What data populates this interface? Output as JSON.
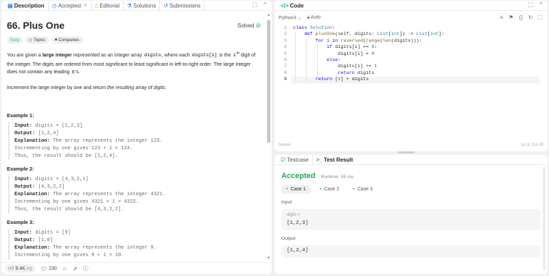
{
  "left_tabs": [
    {
      "label": "Description",
      "icon": "document-icon"
    },
    {
      "label": "Accepted",
      "icon": "clock-icon"
    },
    {
      "label": "Editorial",
      "icon": "book-icon"
    },
    {
      "label": "Solutions",
      "icon": "flask-icon"
    },
    {
      "label": "Submissions",
      "icon": "history-icon"
    }
  ],
  "problem": {
    "title": "66. Plus One",
    "status": "Solved",
    "difficulty": "Easy",
    "tag_topics": "Topics",
    "tag_companies": "Companies",
    "p1_a": "You are given a ",
    "p1_b": "large integer",
    "p1_c": " represented as an integer array ",
    "p1_code1": "digits",
    "p1_d": ", where each ",
    "p1_code2": "digits[i]",
    "p1_e": " is the ",
    "p1_sup_base": "i",
    "p1_sup": "th",
    "p1_f": " digit of the integer. The digits are ordered from most significant to least significant in left-to-right order. The large integer does not contain any leading ",
    "p1_code3": "0",
    "p1_g": "'s.",
    "p2_a": "Increment the large integer by one and return ",
    "p2_i": "the resulting array of digits",
    "p2_b": "."
  },
  "examples": [
    {
      "heading": "Example 1:",
      "input": "digits = [1,2,3]",
      "output": "[1,2,4]",
      "expl1": "The array represents the integer 123.",
      "expl2": "Incrementing by one gives 123 + 1 = 124.",
      "expl3": "Thus, the result should be [1,2,4]."
    },
    {
      "heading": "Example 2:",
      "input": "digits = [4,3,2,1]",
      "output": "[4,3,2,2]",
      "expl1": "The array represents the integer 4321.",
      "expl2": "Incrementing by one gives 4321 + 1 = 4322.",
      "expl3": "Thus, the result should be [4,3,2,2]."
    },
    {
      "heading": "Example 3:",
      "input": "digits = [9]",
      "output": "[1,0]",
      "expl1": "The array represents the integer 9.",
      "expl2": "Incrementing by one gives 9 + 1 = 10."
    }
  ],
  "labels": {
    "input": "Input:",
    "output": "Output:",
    "explanation": "Explanation:"
  },
  "footer": {
    "likes": "9.4K",
    "comments": "230"
  },
  "code_panel": {
    "tab": "Code",
    "language": "Python3",
    "mode": "Auto",
    "status_left": "Saved",
    "status_right": "Ln 9, Col 28",
    "line_numbers": [
      "1",
      "2",
      "3",
      "4",
      "5",
      "6",
      "7",
      "8",
      "9"
    ]
  },
  "result_panel": {
    "tab_testcase": "Testcase",
    "tab_result": "Test Result",
    "verdict": "Accepted",
    "runtime": "Runtime: 55 ms",
    "cases": [
      "Case 1",
      "Case 2",
      "Case 3"
    ],
    "input_label": "Input",
    "var_name": "digits =",
    "input_value": "[1,2,3]",
    "output_label": "Output",
    "output_value": "[1,2,4]"
  }
}
